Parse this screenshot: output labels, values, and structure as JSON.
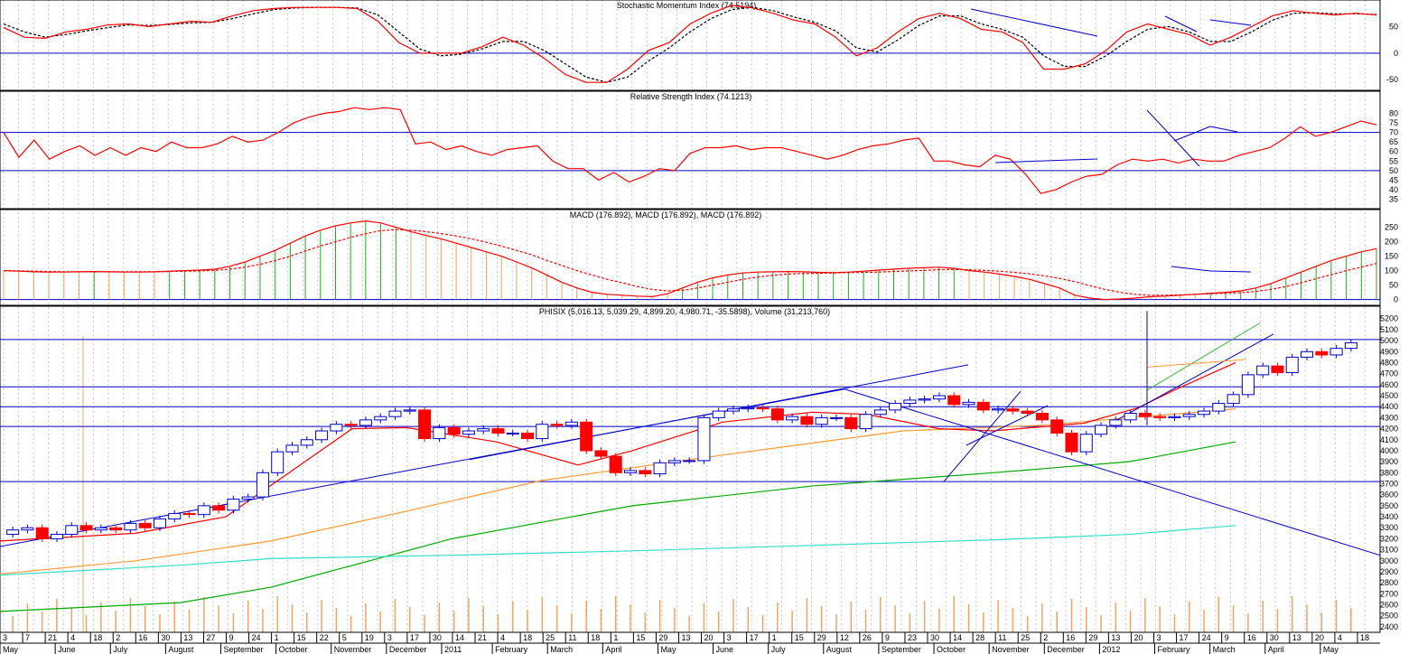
{
  "panels": {
    "smi": {
      "title": "Stochastic Momentum Index (74.5194)",
      "yticks": [
        "50",
        "0",
        "-50"
      ]
    },
    "rsi": {
      "title": "Relative Strength Index (74.1213)",
      "yticks": [
        "80",
        "75",
        "70",
        "65",
        "60",
        "55",
        "50",
        "45",
        "40",
        "35"
      ]
    },
    "macd": {
      "title": "MACD (176.892), MACD (176.892), MACD (176.892)",
      "yticks": [
        "250",
        "200",
        "150",
        "100",
        "50",
        "0"
      ]
    },
    "price": {
      "title": "PHISIX (5,016.13, 5,039.29, 4,899.20, 4,980.71, -35.5898), Volume (31,213,760)",
      "yticks": [
        "5200",
        "5100",
        "5000",
        "4900",
        "4800",
        "4700",
        "4600",
        "4500",
        "4400",
        "4300",
        "4200",
        "4100",
        "4000",
        "3900",
        "3800",
        "3700",
        "3600",
        "3500",
        "3400",
        "3300",
        "3200",
        "3100",
        "3000",
        "2900",
        "2800",
        "2700",
        "2600",
        "2500",
        "2400"
      ]
    }
  },
  "colors": {
    "grid_blue": "#0000cc",
    "up_candle": "#ffffff",
    "down_candle": "#ff0000",
    "ma_red": "#ff0000",
    "ma_orange": "#ff9933",
    "ma_green": "#00aa00",
    "ma_cyan": "#33ddcc",
    "volume": "#f4a460"
  },
  "xaxis": {
    "days": [
      "3",
      "7",
      "21",
      "4",
      "18",
      "2",
      "16",
      "30",
      "13",
      "27",
      "9",
      "24",
      "1",
      "15",
      "22",
      "5",
      "19",
      "3",
      "17",
      "30",
      "14",
      "21",
      "4",
      "18",
      "25",
      "11",
      "18",
      "1",
      "15",
      "29",
      "13",
      "20",
      "3",
      "17",
      "1",
      "15",
      "29",
      "12",
      "26",
      "9",
      "23",
      "30",
      "14",
      "28",
      "11",
      "25",
      "2",
      "16",
      "29",
      "13",
      "20",
      "3",
      "17",
      "24",
      "9",
      "16",
      "30",
      "13",
      "20",
      "4",
      "18"
    ],
    "months": [
      "May",
      "June",
      "July",
      "August",
      "September",
      "October",
      "November",
      "December",
      "2011",
      "February",
      "March",
      "April",
      "May",
      "June",
      "July",
      "August",
      "September",
      "October",
      "November",
      "December",
      "2012",
      "February",
      "March",
      "April",
      "May"
    ]
  },
  "chart_data": [
    {
      "type": "line",
      "title": "Stochastic Momentum Index (74.5194)",
      "ylim": [
        -70,
        100
      ],
      "series": [
        {
          "values": [
            48,
            30,
            28,
            40,
            45,
            53,
            55,
            50,
            55,
            60,
            58,
            70,
            80,
            84,
            86,
            86,
            86,
            84,
            60,
            20,
            0,
            0,
            0,
            12,
            30,
            15,
            -10,
            -40,
            -55,
            -55,
            -30,
            5,
            20,
            55,
            75,
            90,
            85,
            75,
            62,
            55,
            30,
            -5,
            10,
            40,
            65,
            75,
            65,
            45,
            40,
            20,
            -30,
            -30,
            -20,
            5,
            40,
            55,
            45,
            35,
            15,
            30,
            50,
            70,
            80,
            75,
            72,
            75,
            72
          ]
        },
        {
          "values": [
            55,
            40,
            30,
            35,
            42,
            48,
            53,
            52,
            54,
            57,
            58,
            65,
            74,
            82,
            85,
            86,
            86,
            85,
            72,
            40,
            8,
            -5,
            -2,
            8,
            22,
            22,
            5,
            -20,
            -45,
            -55,
            -45,
            -15,
            10,
            40,
            65,
            82,
            86,
            80,
            68,
            58,
            42,
            10,
            2,
            25,
            52,
            70,
            70,
            55,
            45,
            30,
            -5,
            -25,
            -25,
            -5,
            22,
            45,
            50,
            40,
            22,
            22,
            40,
            62,
            75,
            76,
            74,
            74,
            73
          ]
        }
      ]
    },
    {
      "type": "line",
      "title": "Relative Strength Index (74.1213)",
      "ylim": [
        30,
        85
      ],
      "series": [
        {
          "values": [
            70,
            57,
            66,
            56,
            60,
            63,
            58,
            62,
            58,
            62,
            60,
            65,
            62,
            62,
            64,
            68,
            65,
            66,
            70,
            75,
            78,
            80,
            81,
            83,
            82,
            83,
            82,
            64,
            65,
            61,
            63,
            60,
            58,
            61,
            62,
            63,
            55,
            51,
            51,
            45,
            49,
            44,
            47,
            51,
            50,
            59,
            62,
            62,
            63,
            61,
            62,
            62,
            60,
            58,
            56,
            58,
            61,
            63,
            64,
            66,
            67,
            55,
            55,
            53,
            52,
            58,
            56,
            48,
            38,
            40,
            44,
            47,
            48,
            53,
            56,
            55,
            56,
            54,
            56,
            55,
            55,
            58,
            60,
            62,
            67,
            73,
            68,
            70,
            73,
            76,
            74
          ]
        }
      ]
    },
    {
      "type": "line",
      "title": "MACD (176.892), MACD (176.892), MACD (176.892)",
      "ylim": [
        -20,
        280
      ],
      "series": [
        {
          "values": [
            100,
            98,
            96,
            95,
            95,
            96,
            97,
            96,
            95,
            95,
            96,
            98,
            100,
            102,
            105,
            115,
            130,
            150,
            170,
            195,
            220,
            240,
            255,
            265,
            272,
            265,
            250,
            235,
            222,
            210,
            195,
            180,
            165,
            150,
            130,
            110,
            85,
            60,
            40,
            25,
            18,
            15,
            12,
            10,
            20,
            40,
            60,
            75,
            85,
            92,
            95,
            96,
            97,
            96,
            94,
            93,
            95,
            98,
            102,
            105,
            108,
            110,
            112,
            108,
            100,
            95,
            88,
            80,
            70,
            55,
            40,
            15,
            5,
            0,
            2,
            5,
            10,
            12,
            15,
            18,
            22,
            25,
            30,
            40,
            55,
            75,
            95,
            115,
            135,
            150,
            165,
            176
          ]
        },
        {
          "values": [
            100,
            99,
            98,
            97,
            96,
            96,
            96,
            96,
            96,
            96,
            96,
            97,
            98,
            99,
            101,
            105,
            112,
            122,
            135,
            150,
            168,
            185,
            200,
            215,
            228,
            238,
            242,
            240,
            235,
            228,
            220,
            210,
            198,
            185,
            170,
            155,
            135,
            118,
            100,
            85,
            70,
            58,
            45,
            35,
            30,
            32,
            40,
            50,
            60,
            70,
            78,
            84,
            88,
            90,
            91,
            92,
            93,
            94,
            95,
            97,
            99,
            101,
            103,
            104,
            103,
            101,
            98,
            94,
            89,
            82,
            73,
            62,
            48,
            35,
            25,
            18,
            15,
            15,
            16,
            18,
            20,
            22,
            24,
            28,
            35,
            45,
            58,
            72,
            86,
            100,
            112,
            125
          ]
        }
      ]
    },
    {
      "type": "bar",
      "title": "PHISIX (5,016.13, 5,039.29, 4,899.20, 4,980.71, -35.5898), Volume (31,213,760)",
      "ylim": [
        2350,
        5280
      ],
      "series": [
        {
          "name": "close",
          "values": [
            3280,
            3300,
            3200,
            3240,
            3320,
            3280,
            3300,
            3280,
            3340,
            3300,
            3380,
            3430,
            3420,
            3500,
            3460,
            3560,
            3580,
            3800,
            3990,
            4050,
            4100,
            4180,
            4240,
            4230,
            4280,
            4310,
            4360,
            4370,
            4110,
            4210,
            4150,
            4180,
            4200,
            4160,
            4160,
            4110,
            4240,
            4230,
            4260,
            4000,
            3950,
            3800,
            3820,
            3790,
            3890,
            3910,
            3910,
            4300,
            4360,
            4380,
            4390,
            4380,
            4280,
            4310,
            4240,
            4300,
            4300,
            4200,
            4330,
            4370,
            4430,
            4460,
            4470,
            4500,
            4420,
            4440,
            4370,
            4380,
            4360,
            4340,
            4280,
            4160,
            3990,
            4150,
            4230,
            4280,
            4340,
            4310,
            4300,
            4310,
            4330,
            4360,
            4430,
            4510,
            4690,
            4770,
            4710,
            4850,
            4900,
            4870,
            4930,
            4981
          ]
        }
      ]
    }
  ]
}
